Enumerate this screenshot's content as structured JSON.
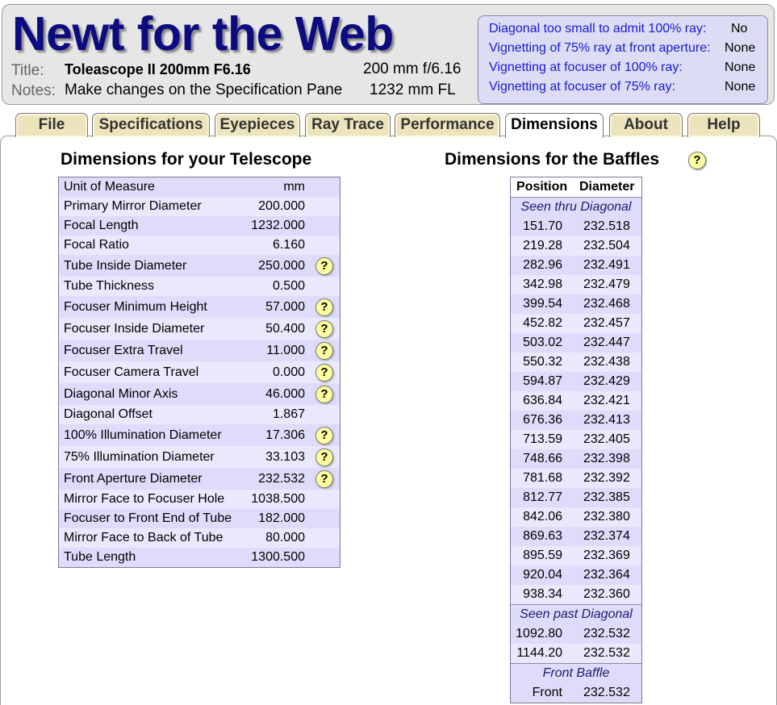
{
  "header": {
    "app_title": "Newt for the Web",
    "title_label": "Title:",
    "title_value": "Toleascope II 200mm F6.16",
    "notes_label": "Notes:",
    "notes_value": "Make changes on the Specification Pane",
    "spec_aperture": "200 mm f/6.16",
    "spec_focal_length": "1232 mm FL"
  },
  "warnings": [
    {
      "label": "Diagonal too small to admit 100% ray:",
      "value": "No"
    },
    {
      "label": "Vignetting of 75% ray at front aperture:",
      "value": "None"
    },
    {
      "label": "Vignetting at focuser of 100% ray:",
      "value": "None"
    },
    {
      "label": "Vignetting at focuser of  75% ray:",
      "value": "None"
    }
  ],
  "tabs": [
    {
      "label": "File"
    },
    {
      "label": "Specifications"
    },
    {
      "label": "Eyepieces"
    },
    {
      "label": "Ray Trace"
    },
    {
      "label": "Performance"
    },
    {
      "label": "Dimensions",
      "active": true
    },
    {
      "label": "About"
    },
    {
      "label": "Help"
    }
  ],
  "dimensions": {
    "title": "Dimensions for your Telescope",
    "help_glyph": "?",
    "rows": [
      {
        "label": "Unit of Measure",
        "value": "mm",
        "help": false
      },
      {
        "label": "Primary Mirror Diameter",
        "value": "200.000",
        "help": false
      },
      {
        "label": "Focal Length",
        "value": "1232.000",
        "help": false
      },
      {
        "label": "Focal Ratio",
        "value": "6.160",
        "help": false
      },
      {
        "label": "Tube Inside Diameter",
        "value": "250.000",
        "help": true
      },
      {
        "label": "Tube Thickness",
        "value": "0.500",
        "help": false
      },
      {
        "label": "Focuser Minimum Height",
        "value": "57.000",
        "help": true
      },
      {
        "label": "Focuser Inside Diameter",
        "value": "50.400",
        "help": true
      },
      {
        "label": "Focuser Extra Travel",
        "value": "11.000",
        "help": true
      },
      {
        "label": "Focuser Camera Travel",
        "value": "0.000",
        "help": true
      },
      {
        "label": "Diagonal Minor Axis",
        "value": "46.000",
        "help": true
      },
      {
        "label": "Diagonal Offset",
        "value": "1.867",
        "help": false
      },
      {
        "label": "100% Illumination Diameter",
        "value": "17.306",
        "help": true
      },
      {
        "label": "75% Illumination Diameter",
        "value": "33.103",
        "help": true
      },
      {
        "label": "Front Aperture Diameter",
        "value": "232.532",
        "help": true
      },
      {
        "label": "Mirror Face to Focuser Hole",
        "value": "1038.500",
        "help": false
      },
      {
        "label": "Focuser to Front End of Tube",
        "value": "182.000",
        "help": false
      },
      {
        "label": "Mirror Face to Back of Tube",
        "value": "80.000",
        "help": false
      },
      {
        "label": "Tube Length",
        "value": "1300.500",
        "help": false
      }
    ]
  },
  "baffles": {
    "title": "Dimensions for the Baffles",
    "help_glyph": "?",
    "col_position": "Position",
    "col_diameter": "Diameter",
    "groups": [
      {
        "heading": "Seen thru Diagonal",
        "rows": [
          {
            "position": "151.70",
            "diameter": "232.518"
          },
          {
            "position": "219.28",
            "diameter": "232.504"
          },
          {
            "position": "282.96",
            "diameter": "232.491"
          },
          {
            "position": "342.98",
            "diameter": "232.479"
          },
          {
            "position": "399.54",
            "diameter": "232.468"
          },
          {
            "position": "452.82",
            "diameter": "232.457"
          },
          {
            "position": "503.02",
            "diameter": "232.447"
          },
          {
            "position": "550.32",
            "diameter": "232.438"
          },
          {
            "position": "594.87",
            "diameter": "232.429"
          },
          {
            "position": "636.84",
            "diameter": "232.421"
          },
          {
            "position": "676.36",
            "diameter": "232.413"
          },
          {
            "position": "713.59",
            "diameter": "232.405"
          },
          {
            "position": "748.66",
            "diameter": "232.398"
          },
          {
            "position": "781.68",
            "diameter": "232.392"
          },
          {
            "position": "812.77",
            "diameter": "232.385"
          },
          {
            "position": "842.06",
            "diameter": "232.380"
          },
          {
            "position": "869.63",
            "diameter": "232.374"
          },
          {
            "position": "895.59",
            "diameter": "232.369"
          },
          {
            "position": "920.04",
            "diameter": "232.364"
          },
          {
            "position": "938.34",
            "diameter": "232.360"
          }
        ]
      },
      {
        "heading": "Seen past Diagonal",
        "rows": [
          {
            "position": "1092.80",
            "diameter": "232.532"
          },
          {
            "position": "1144.20",
            "diameter": "232.532"
          }
        ]
      },
      {
        "heading": "Front Baffle",
        "rows": [
          {
            "position": "Front",
            "diameter": "232.532"
          }
        ]
      }
    ]
  }
}
